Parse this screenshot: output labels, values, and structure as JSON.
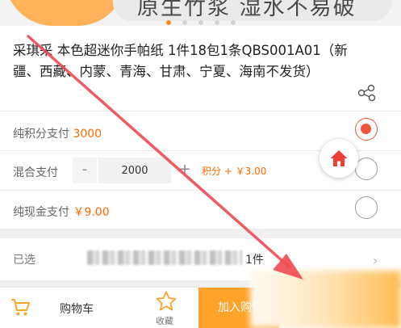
{
  "banner": {
    "text": "原生竹浆 湿水不易破",
    "dots": 5,
    "active_dot": 0
  },
  "product": {
    "title": "采琪采 本色超迷你手帕纸 1件18包1条QBS001A01（新疆、西藏、内蒙、青海、甘肃、宁夏、海南不发货）"
  },
  "payment": {
    "points": {
      "label": "纯积分支付",
      "value": "3000",
      "selected": true
    },
    "mixed": {
      "label": "混合支付",
      "minus": "-",
      "input_value": "2000",
      "plus": "+",
      "extra": "积分 + ￥3.00",
      "selected": false
    },
    "cash": {
      "label": "纯现金支付",
      "value": "￥9.00",
      "selected": false
    }
  },
  "selection": {
    "label": "已选",
    "value": "1件"
  },
  "bottom_bar": {
    "cart_label": "购物车",
    "favorite_label": "收藏",
    "add_to_cart_label": "加入购物车"
  },
  "colors": {
    "accent": "#ff6a00",
    "radio_active": "#f2553a",
    "add_to_cart_bg": "#ffa32a",
    "annotation_arrow": "#ef4d55"
  },
  "icons": {
    "share": "share-icon",
    "home": "home-icon",
    "cart": "cart-icon",
    "favorite": "star-icon",
    "chevron": "chevron-right-icon"
  }
}
